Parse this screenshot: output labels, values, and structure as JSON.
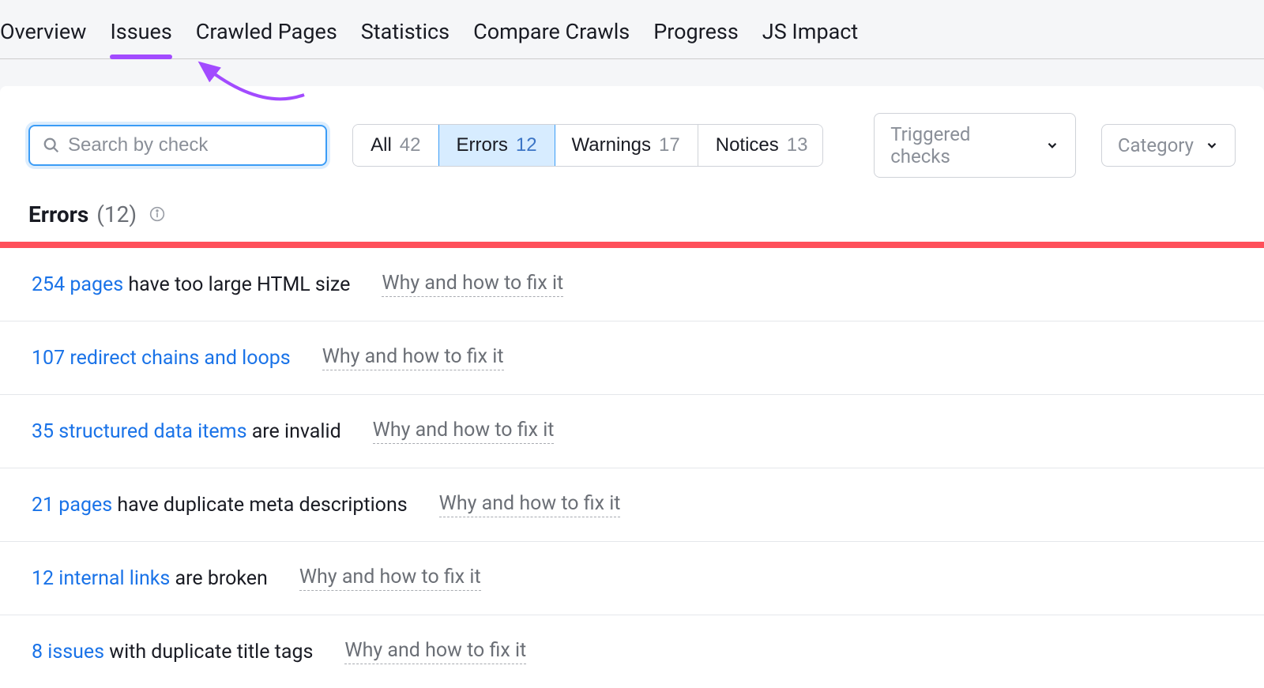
{
  "tabs": [
    {
      "label": "Overview"
    },
    {
      "label": "Issues"
    },
    {
      "label": "Crawled Pages"
    },
    {
      "label": "Statistics"
    },
    {
      "label": "Compare Crawls"
    },
    {
      "label": "Progress"
    },
    {
      "label": "JS Impact"
    }
  ],
  "active_tab_index": 1,
  "search": {
    "placeholder": "Search by check"
  },
  "filters": [
    {
      "label": "All",
      "count": "42"
    },
    {
      "label": "Errors",
      "count": "12"
    },
    {
      "label": "Warnings",
      "count": "17"
    },
    {
      "label": "Notices",
      "count": "13"
    }
  ],
  "active_filter_index": 1,
  "dropdowns": {
    "triggered": "Triggered checks",
    "category": "Category"
  },
  "section": {
    "title": "Errors",
    "count": "(12)"
  },
  "fix_text": "Why and how to fix it",
  "issues": [
    {
      "link": "254 pages",
      "text": " have too large HTML size"
    },
    {
      "link": "107 redirect chains and loops",
      "text": ""
    },
    {
      "link": "35 structured data items",
      "text": " are invalid"
    },
    {
      "link": "21 pages",
      "text": " have duplicate meta descriptions"
    },
    {
      "link": "12 internal links",
      "text": " are broken"
    },
    {
      "link": "8 issues",
      "text": " with duplicate title tags"
    }
  ]
}
